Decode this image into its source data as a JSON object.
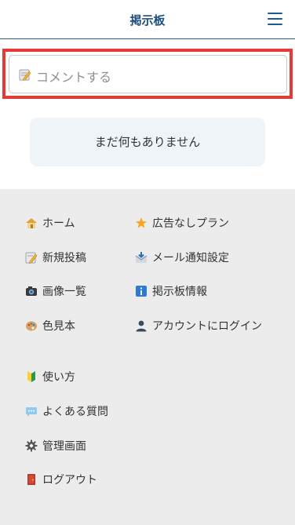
{
  "header": {
    "title": "掲示板"
  },
  "comment": {
    "placeholder": "コメントする"
  },
  "empty_message": "まだ何もありません",
  "footer": {
    "left_items": [
      {
        "label": "ホーム",
        "icon": "home-icon"
      },
      {
        "label": "新規投稿",
        "icon": "memo-icon"
      },
      {
        "label": "画像一覧",
        "icon": "camera-icon"
      },
      {
        "label": "色見本",
        "icon": "palette-icon"
      },
      {
        "label": "使い方",
        "icon": "beginner-icon"
      },
      {
        "label": "よくある質問",
        "icon": "speech-bubble-icon"
      },
      {
        "label": "管理画面",
        "icon": "gear-icon"
      },
      {
        "label": "ログアウト",
        "icon": "door-icon"
      }
    ],
    "right_items": [
      {
        "label": "広告なしプラン",
        "icon": "star-icon"
      },
      {
        "label": "メール通知設定",
        "icon": "mail-icon"
      },
      {
        "label": "掲示板情報",
        "icon": "info-icon"
      },
      {
        "label": "アカウントにログイン",
        "icon": "user-icon"
      }
    ]
  },
  "colors": {
    "accent": "#1e4f80",
    "highlight": "#e53935",
    "footer_bg": "#ececec",
    "empty_bg": "#eef4f8"
  }
}
